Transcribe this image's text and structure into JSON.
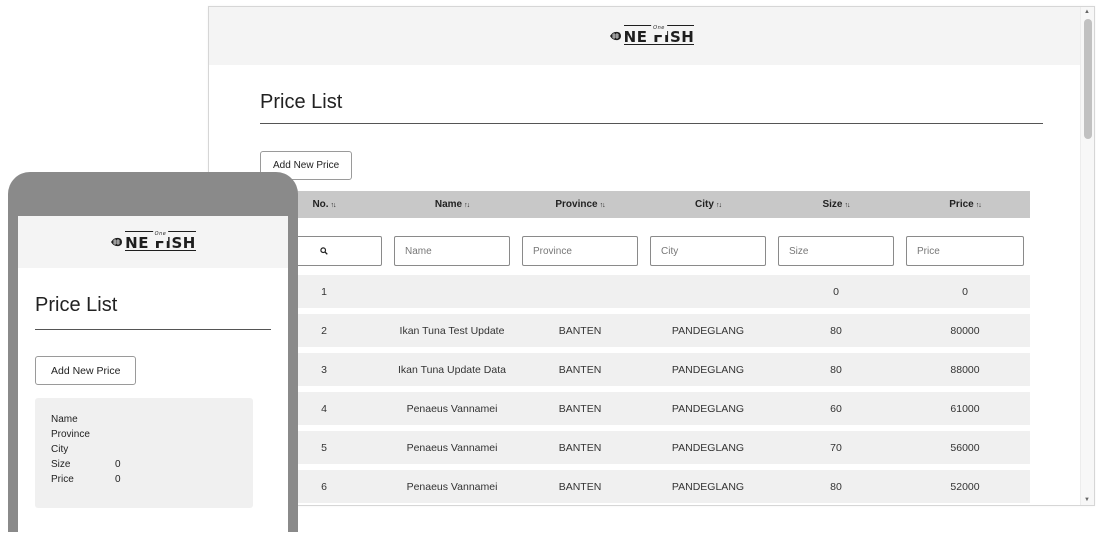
{
  "brand": {
    "top": "One",
    "text": "NE FISH"
  },
  "desktop": {
    "title": "Price List",
    "add_button": "Add New Price",
    "columns": [
      "No.",
      "Name",
      "Province",
      "City",
      "Size",
      "Price"
    ],
    "sort_glyph": "↑↓",
    "filter_placeholders": {
      "name": "Name",
      "province": "Province",
      "city": "City",
      "size": "Size",
      "price": "Price"
    },
    "rows": [
      {
        "no": "1",
        "name": "",
        "province": "",
        "city": "",
        "size": "0",
        "price": "0"
      },
      {
        "no": "2",
        "name": "Ikan Tuna Test Update",
        "province": "BANTEN",
        "city": "PANDEGLANG",
        "size": "80",
        "price": "80000"
      },
      {
        "no": "3",
        "name": "Ikan Tuna Update Data",
        "province": "BANTEN",
        "city": "PANDEGLANG",
        "size": "80",
        "price": "88000"
      },
      {
        "no": "4",
        "name": "Penaeus Vannamei",
        "province": "BANTEN",
        "city": "PANDEGLANG",
        "size": "60",
        "price": "61000"
      },
      {
        "no": "5",
        "name": "Penaeus Vannamei",
        "province": "BANTEN",
        "city": "PANDEGLANG",
        "size": "70",
        "price": "56000"
      },
      {
        "no": "6",
        "name": "Penaeus Vannamei",
        "province": "BANTEN",
        "city": "PANDEGLANG",
        "size": "80",
        "price": "52000"
      }
    ]
  },
  "mobile": {
    "title": "Price List",
    "add_button": "Add New Price",
    "card": {
      "name_label": "Name",
      "province_label": "Province",
      "city_label": "City",
      "size_label": "Size",
      "size_value": "0",
      "price_label": "Price",
      "price_value": "0"
    }
  },
  "colors": {
    "header_bg": "#f4f4f4",
    "table_head": "#c8c8c8",
    "row_bg": "#f0f0f0",
    "phone_frame": "#8a8a8a"
  }
}
